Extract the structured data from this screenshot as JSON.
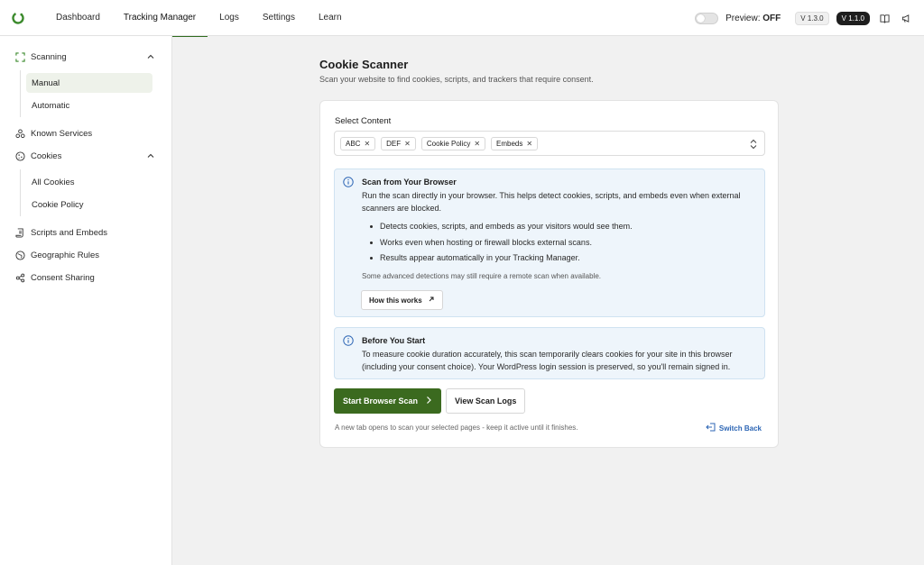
{
  "nav": {
    "items": [
      {
        "label": "Dashboard"
      },
      {
        "label": "Tracking Manager"
      },
      {
        "label": "Logs"
      },
      {
        "label": "Settings"
      },
      {
        "label": "Learn"
      }
    ],
    "preview_label": "Preview:",
    "preview_state": "OFF",
    "plugin_version": "V 1.3.0",
    "pro_version": "V 1.1.0"
  },
  "sidebar": {
    "scanning": "Scanning",
    "manual": "Manual",
    "automatic": "Automatic",
    "known_services": "Known Services",
    "cookies": "Cookies",
    "all_cookies": "All Cookies",
    "cookie_policy": "Cookie Policy",
    "scripts_embeds": "Scripts and Embeds",
    "geographic_rules": "Geographic Rules",
    "consent_sharing": "Consent Sharing"
  },
  "main": {
    "title": "Cookie Scanner",
    "subtitle": "Scan your website to find cookies, scripts, and trackers that require consent.",
    "select_label": "Select Content",
    "chips": [
      "ABC",
      "DEF",
      "Cookie Policy",
      "Embeds"
    ],
    "browser_box": {
      "title": "Scan from Your Browser",
      "text": "Run the scan directly in your browser. This helps detect cookies, scripts, and embeds even when external scanners are blocked.",
      "bullets": [
        "Detects cookies, scripts, and embeds as your visitors would see them.",
        "Works even when hosting or firewall blocks external scans.",
        "Results appear automatically in your Tracking Manager."
      ],
      "note": "Some advanced detections may still require a remote scan when available.",
      "how_button": "How this works"
    },
    "before_box": {
      "title": "Before You Start",
      "text": "To measure cookie duration accurately, this scan temporarily clears cookies for your site in this browser (including your consent choice). Your WordPress login session is preserved, so you'll remain signed in."
    },
    "start_button": "Start Browser Scan",
    "logs_button": "View Scan Logs",
    "footnote": "A new tab opens to scan your selected pages - keep it active until it finishes.",
    "switch_back": "Switch Back"
  },
  "colors": {
    "brand": "#3b6a1f",
    "info_bg": "#eef5fb",
    "link": "#2d66b5"
  }
}
